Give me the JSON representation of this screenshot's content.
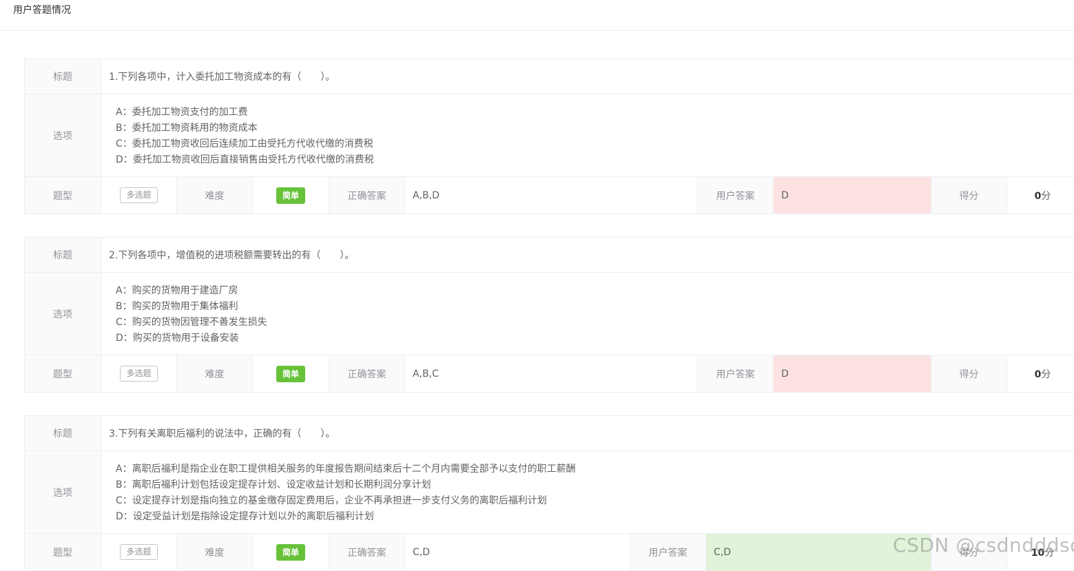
{
  "page": {
    "title": "用户答题情况"
  },
  "labels": {
    "title": "标题",
    "options": "选项",
    "type": "题型",
    "difficulty": "难度",
    "correct_answer": "正确答案",
    "user_answer": "用户答案",
    "score": "得分"
  },
  "questions": [
    {
      "title": "1.下列各项中，计入委托加工物资成本的有（　　）。",
      "options": [
        "A：委托加工物资支付的加工费",
        "B：委托加工物资耗用的物资成本",
        "C：委托加工物资收回后连续加工由受托方代收代缴的消费税",
        "D：委托加工物资收回后直接销售由受托方代收代缴的消费税"
      ],
      "type": "多选题",
      "difficulty": "简单",
      "correct_answer": "A,B,D",
      "user_answer": "D",
      "score": "0",
      "score_unit": "分",
      "result": "wrong"
    },
    {
      "title": "2.下列各项中，增值税的进项税额需要转出的有（　　）。",
      "options": [
        "A：购买的货物用于建造厂房",
        "B：购买的货物用于集体福利",
        "C：购买的货物因管理不善发生损失",
        "D：购买的货物用于设备安装"
      ],
      "type": "多选题",
      "difficulty": "简单",
      "correct_answer": "A,B,C",
      "user_answer": "D",
      "score": "0",
      "score_unit": "分",
      "result": "wrong"
    },
    {
      "title": "3.下列有关离职后福利的说法中，正确的有（　　）。",
      "options": [
        "A：离职后福利是指企业在职工提供相关服务的年度报告期间结束后十二个月内需要全部予以支付的职工薪酬",
        "B：离职后福利计划包括设定提存计划、设定收益计划和长期利润分享计划",
        "C：设定提存计划是指向独立的基金缴存固定费用后，企业不再承担进一步支付义务的离职后福利计划",
        "D：设定受益计划是指除设定提存计划以外的离职后福利计划"
      ],
      "type": "多选题",
      "difficulty": "简单",
      "correct_answer": "C,D",
      "user_answer": "C,D",
      "score": "10",
      "score_unit": "分",
      "result": "right"
    }
  ],
  "watermark": "CSDN @csdndddsd",
  "colors": {
    "wrong_bg": "#fde2e2",
    "right_bg": "#e1f3d8",
    "tag_success": "#67c23a",
    "label_bg": "#fafafa",
    "border": "#ebeef5"
  }
}
